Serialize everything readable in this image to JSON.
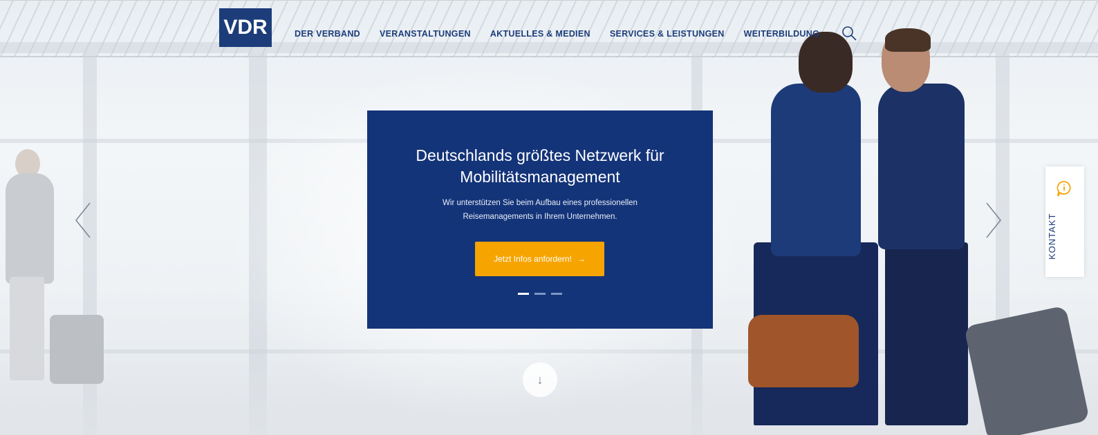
{
  "brand": {
    "logo_text": "VDR",
    "primary_color": "#1c3d7a",
    "accent_color": "#f6a400"
  },
  "nav": {
    "items": [
      {
        "label": "DER VERBAND"
      },
      {
        "label": "VERANSTALTUNGEN"
      },
      {
        "label": "AKTUELLES & MEDIEN"
      },
      {
        "label": "SERVICES & LEISTUNGEN"
      },
      {
        "label": "WEITERBILDUNG"
      }
    ],
    "search_icon": "search-icon"
  },
  "hero": {
    "title_line1": "Deutschlands größtes Netzwerk für",
    "title_line2": "Mobilitätsmanagement",
    "subtitle_line1": "Wir unterstützen Sie beim Aufbau eines professionellen",
    "subtitle_line2": "Reisemanagements in Ihrem Unternehmen.",
    "cta_label": "Jetzt Infos anfordern!",
    "cta_arrow": "→",
    "slides_total": 3,
    "active_slide": 1
  },
  "carousel": {
    "prev_icon": "chevron-left-icon",
    "next_icon": "chevron-right-icon"
  },
  "scroll_down": {
    "icon": "arrow-down-icon",
    "glyph": "↓"
  },
  "contact_tab": {
    "label": "KONTAKT",
    "icon": "chat-info-icon"
  }
}
